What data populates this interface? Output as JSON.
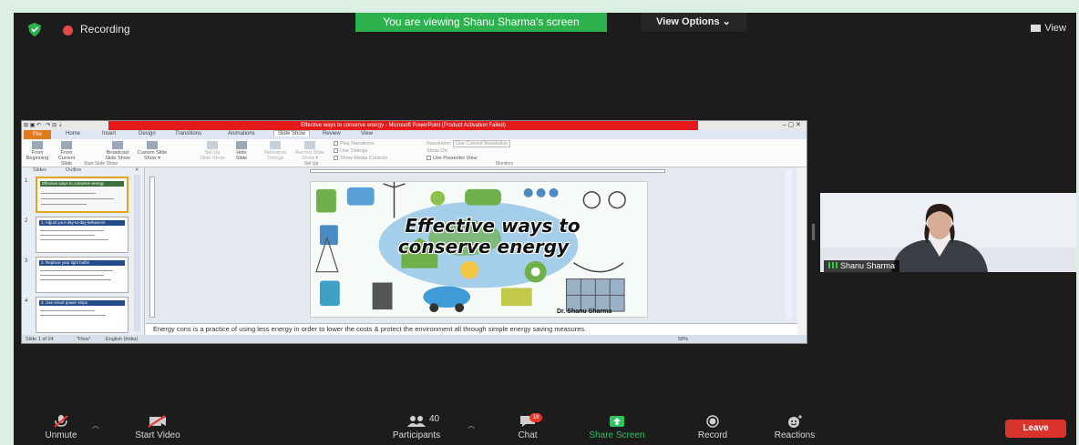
{
  "topbar": {
    "recording_label": "Recording",
    "viewing_banner": "You are viewing Shanu Sharma's screen",
    "view_options_label": "View Options ⌄",
    "view_label": "View"
  },
  "ppt": {
    "title": "Effective ways to conserve energy - Microsoft PowerPoint (Product Activation Failed)",
    "quick_access": "⊞ ▣ ↶ · ↷ ⊟ ⇣",
    "window_controls": "–  ▢  ✕",
    "tabs": [
      "File",
      "Home",
      "Insert",
      "Design",
      "Transitions",
      "Animations",
      "Slide Show",
      "Review",
      "View"
    ],
    "ribbon": {
      "btn_from_beginning": "From Beginning",
      "btn_from_current": "From Current Slide",
      "btn_broadcast": "Broadcast Slide Show",
      "btn_custom": "Custom Slide Show ▾",
      "btn_setup": "Set Up Slide Show",
      "btn_hide": "Hide Slide",
      "btn_rehearse": "Rehearse Timings",
      "btn_record": "Record Slide Show ▾",
      "chk_play_narrations": "Play Narrations",
      "chk_use_timings": "Use Timings",
      "chk_show_media": "Show Media Controls",
      "resolution_label": "Resolution:",
      "resolution_value": "Use Current Resolution",
      "show_on_label": "Show On:",
      "chk_presenter_view": "Use Presenter View",
      "group_start": "Start Slide Show",
      "group_setup": "Set Up",
      "group_monitors": "Monitors"
    },
    "left_pane": {
      "tab_slides": "Slides",
      "tab_outline": "Outline",
      "close": "✕",
      "thumbs": [
        {
          "num": "1",
          "title": "Effective ways to conserve energy"
        },
        {
          "num": "2",
          "title": "1. Adjust your day-to-day behaviors"
        },
        {
          "num": "3",
          "title": "2. Replace your light bulbs"
        },
        {
          "num": "4",
          "title": "3. Use smart power strips"
        }
      ]
    },
    "slide": {
      "title_line1": "Effective ways to",
      "title_line2": "conserve energy",
      "author": "Dr. Shanu Sharma"
    },
    "notes": "Energy cons is a practice of using less energy in order to lower the costs & protect the environment all through simple energy saving measures.",
    "status": {
      "slide_count": "Slide 1 of 24",
      "theme": "\"Flow\"",
      "language": "English (India)",
      "zoom": "58%"
    }
  },
  "camera": {
    "name": "Shanu Sharma"
  },
  "bottombar": {
    "unmute": "Unmute",
    "start_video": "Start Video",
    "participants": "Participants",
    "participants_count": "40",
    "chat": "Chat",
    "chat_badge": "19",
    "share_screen": "Share Screen",
    "record": "Record",
    "reactions": "Reactions",
    "leave": "Leave"
  },
  "colors": {
    "banner_green": "#2bb24c",
    "leave_red": "#d9342b",
    "ppt_title_red": "#e41a1a",
    "file_tab_orange": "#e07a1e"
  }
}
